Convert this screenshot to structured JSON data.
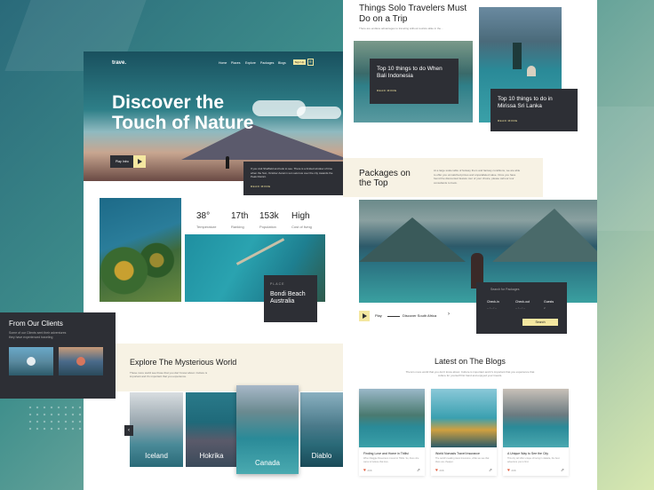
{
  "page1": {
    "nav": {
      "logo": "trave.",
      "links": [
        "Home",
        "Places",
        "Explore",
        "Packages",
        "Blogs"
      ],
      "signup": "Sign Up"
    },
    "hero": {
      "title_line1": "Discover the",
      "title_line2": "Touch of Nature",
      "play_label": "Play Intro",
      "card_text": "If you visit Sheffield and look to see. There is a limited window of time when the Sun, October Autumn sun sets low over the city towards the Peak District.",
      "card_read_more": "READ MORE"
    },
    "stats": [
      {
        "value": "38°",
        "label": "Temperature"
      },
      {
        "value": "17th",
        "label": "Ranking"
      },
      {
        "value": "153k",
        "label": "Population"
      },
      {
        "value": "High",
        "label": "Cost of living"
      }
    ],
    "place": {
      "label": "PLACE",
      "name_line1": "Bondi Beach",
      "name_line2": "Australia"
    },
    "explore": {
      "title": "Explore The Mysterious World",
      "subtitle": "Those more world see those that you don't know about. Culture is important and it's important that you experience.",
      "destinations": [
        "Iceland",
        "Hokrika",
        "Canada",
        "Diablo"
      ]
    }
  },
  "clients": {
    "title": "From Our Clients",
    "subtitle": "Some of our Clients sent their adventures they have experienced traveling"
  },
  "page2": {
    "solo": {
      "title": "Things Solo Travelers Must Do on a Trip",
      "subtitle": "There are endless advantages to traveling without tourists alike in the...",
      "tip1": "Top 10 things to do When Bali Indonesia",
      "tip2": "Top 10 things to do in Mirissa Sri Lanka",
      "read_more": "READ MORE"
    },
    "packages": {
      "title_line1": "Packages on",
      "title_line2": "the Top",
      "description": "At a large scale table of fantasy them and fantasy conditions, we are able to offer you unmatched prices and unparalleled value. Once you have found the discounted feature tour of your choice, please call our tour consultants to book."
    },
    "search": {
      "placeholder": "Search for Packages",
      "checkin_label": "Check-in",
      "checkin_value": "-- / -- / --",
      "checkout_label": "Check-out",
      "checkout_value": "-- / -- / --",
      "guests_label": "Guests",
      "guests_value": "2",
      "button": "Search"
    },
    "play": {
      "label": "Play",
      "discover": "Discover South Africa"
    },
    "blogs": {
      "title": "Latest on The Blogs",
      "subtitle": "There's more world that you don't know about. Culture is important and it's important that you experience that culture for yourself first hand and enjoyed your travels.",
      "posts": [
        {
          "title": "Finding Love and Home in Tbilisi",
          "date": "When Maggie Rosecrans moved to Tbilisi. So, there she came to believe that love.",
          "likes": "20K"
        },
        {
          "title": "World Nomads Travel Insurance",
          "date": "The world's leading travel insurance, while we see that there are cheaper.",
          "likes": "20K"
        },
        {
          "title": "A Unique Way to See the City",
          "date": "This city will offer unique of being in Jakarta, the best adventure you to find.",
          "likes": "20K"
        }
      ]
    }
  },
  "colors": {
    "accent": "#f4e7a0",
    "dark": "#2d2f35"
  }
}
